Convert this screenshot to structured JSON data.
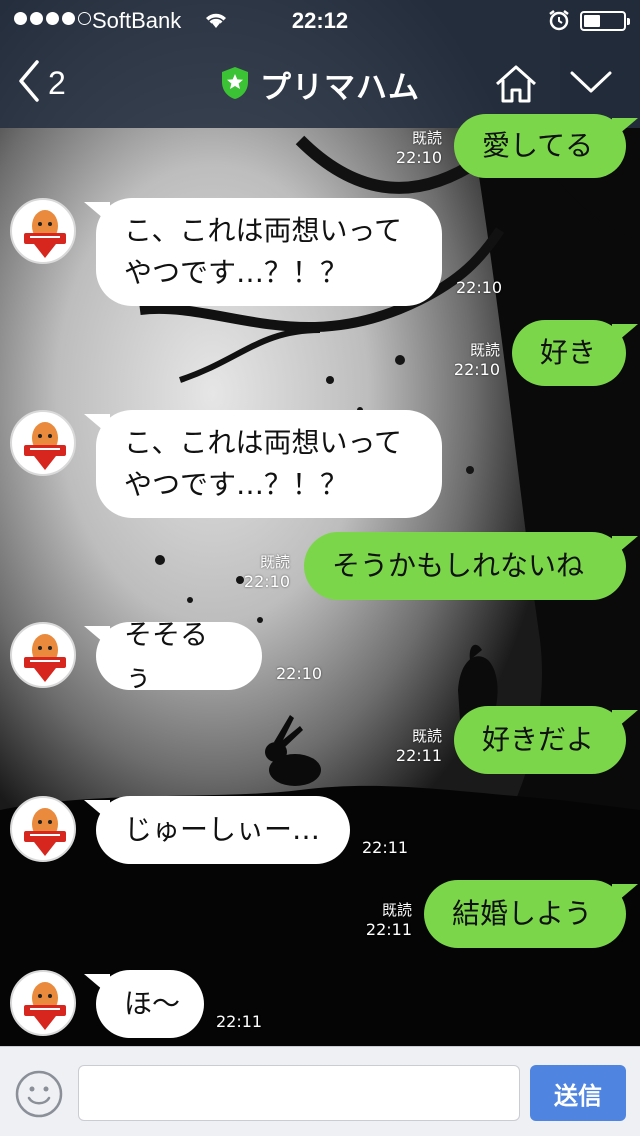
{
  "status_bar": {
    "carrier": "SoftBank",
    "time": "22:12",
    "signal_bars": 4
  },
  "header": {
    "back_count": "2",
    "title": "プリマハム",
    "official_badge": "star-shield-icon"
  },
  "colors": {
    "header_bg": "#263040",
    "incoming_bubble": "#ffffff",
    "outgoing_bubble": "#7bd64a",
    "send_button": "#4f84e0",
    "official_badge": "#3cc235"
  },
  "messages": [
    {
      "direction": "out",
      "text": "愛してる",
      "read": "既読",
      "time": "22:10"
    },
    {
      "direction": "in",
      "lines": [
        "こ、これは両想いって",
        "やつです…？！？"
      ],
      "time": "22:10"
    },
    {
      "direction": "out",
      "text": "好き",
      "read": "既読",
      "time": "22:10"
    },
    {
      "direction": "in",
      "lines": [
        "こ、これは両想いって",
        "やつです…？！？"
      ],
      "time": "22:10"
    },
    {
      "direction": "out",
      "text": "そうかもしれないね",
      "read": "既読",
      "time": "22:10"
    },
    {
      "direction": "in",
      "lines": [
        "そそるぅ"
      ],
      "time": "22:10"
    },
    {
      "direction": "out",
      "text": "好きだよ",
      "read": "既読",
      "time": "22:11"
    },
    {
      "direction": "in",
      "lines": [
        "じゅーしぃー…"
      ],
      "time": "22:11"
    },
    {
      "direction": "out",
      "text": "結婚しよう",
      "read": "既読",
      "time": "22:11"
    },
    {
      "direction": "in",
      "lines": [
        "ほ〜"
      ],
      "time": "22:11"
    }
  ],
  "input": {
    "placeholder": "",
    "send_label": "送信"
  }
}
